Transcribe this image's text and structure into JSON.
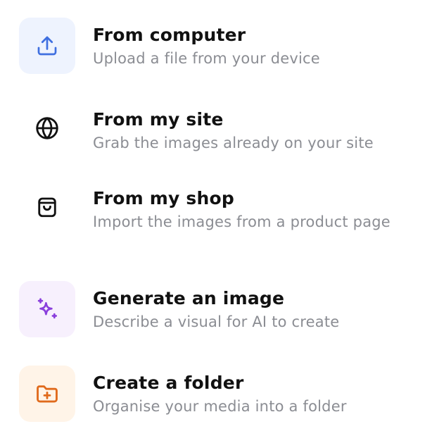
{
  "menu": {
    "items": [
      {
        "title": "From computer",
        "description": "Upload a file from your device",
        "icon": "upload-icon",
        "tile_color": "#eef3fe",
        "icon_color": "#3f6fe0"
      },
      {
        "title": "From my site",
        "description": "Grab the images already on your site",
        "icon": "globe-icon",
        "tile_color": "#ffffff",
        "icon_color": "#111111"
      },
      {
        "title": "From my shop",
        "description": "Import the images from a product page",
        "icon": "shopping-bag-icon",
        "tile_color": "#ffffff",
        "icon_color": "#111111"
      },
      {
        "title": "Generate an image",
        "description": "Describe a visual for AI to create",
        "icon": "sparkles-icon",
        "tile_color": "#f7f0fd",
        "icon_color": "#8a3fdc"
      },
      {
        "title": "Create a folder",
        "description": "Organise your media into a folder",
        "icon": "folder-plus-icon",
        "tile_color": "#fff4e8",
        "icon_color": "#e06a1c"
      }
    ]
  }
}
